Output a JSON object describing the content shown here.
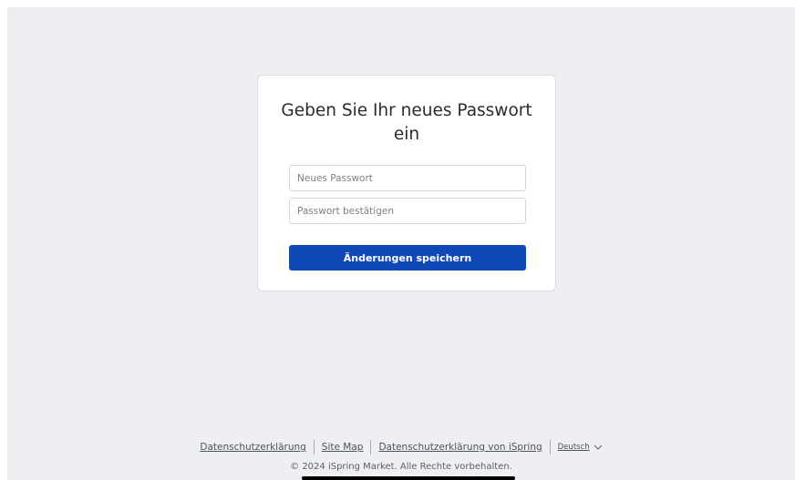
{
  "form": {
    "title": "Geben Sie Ihr neues Passwort ein",
    "new_password_placeholder": "Neues Passwort",
    "confirm_password_placeholder": "Passwort bestätigen",
    "save_label": "Änderungen speichern"
  },
  "footer": {
    "links": [
      {
        "label": "Datenschutzerklärung"
      },
      {
        "label": "Site Map"
      },
      {
        "label": "Datenschutzerklärung von iSpring"
      }
    ],
    "language": "Deutsch",
    "copyright": "© 2024 iSpring Market. Alle Rechte vorbehalten."
  },
  "colors": {
    "page_background": "#eeeff2",
    "card_background": "#ffffff",
    "primary_button": "#1148b8"
  },
  "icons": {
    "language_dropdown": "chevron-down-icon"
  }
}
